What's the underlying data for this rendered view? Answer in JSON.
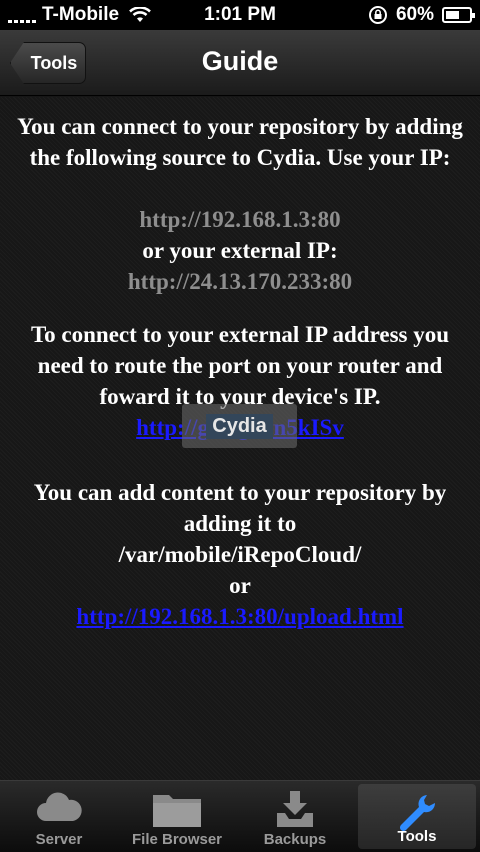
{
  "status": {
    "carrier": "T-Mobile",
    "time": "1:01 PM",
    "battery": "60%",
    "battery_level": 0.6
  },
  "nav": {
    "back_label": "Tools",
    "title": "Guide"
  },
  "guide": {
    "para1": "You can connect to your repository by adding the following source to Cydia. Use your IP:",
    "local_url": "http://192.168.1.3:80",
    "or_external": "or your external IP:",
    "external_url": "http://24.13.170.233:80",
    "para2": "To connect to your external IP address you need to route the port on your router and foward it to your device's IP.",
    "short_link": "http://goo.gl/vn5kISv",
    "para3": "You can add content to your repository by adding it to",
    "path": "/var/mobile/iRepoCloud/",
    "or": "or",
    "upload_url": "http://192.168.1.3:80/upload.html"
  },
  "watermark": "Cydia",
  "tabs": [
    {
      "label": "Server",
      "icon": "cloud-icon"
    },
    {
      "label": "File Browser",
      "icon": "folder-icon"
    },
    {
      "label": "Backups",
      "icon": "download-tray-icon"
    },
    {
      "label": "Tools",
      "icon": "wrench-icon",
      "active": true
    }
  ],
  "colors": {
    "link": "#1a1aff",
    "url_gray": "#8e8e8e",
    "active_icon": "#2f8cff"
  }
}
